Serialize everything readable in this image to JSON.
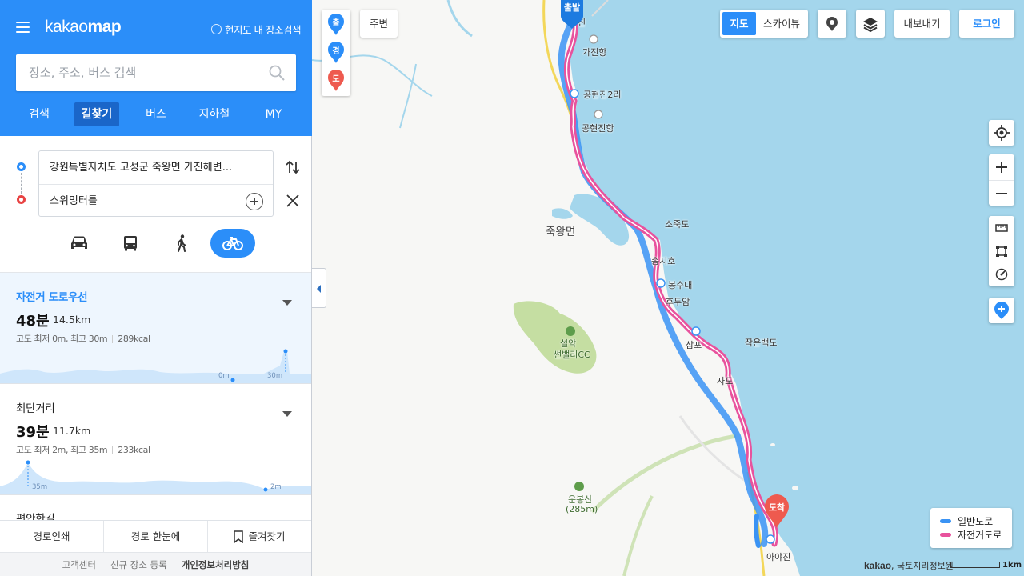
{
  "header": {
    "logo_light": "kakao",
    "logo_bold": "map",
    "local_search_label": "현지도 내 장소검색"
  },
  "search": {
    "placeholder": "장소, 주소, 버스 검색"
  },
  "tabs": [
    {
      "label": "검색"
    },
    {
      "label": "길찾기",
      "active": true
    },
    {
      "label": "버스"
    },
    {
      "label": "지하철"
    },
    {
      "label": "MY"
    }
  ],
  "route": {
    "origin": "강원특별자치도 고성군 죽왕면 가진해변...",
    "destination": "스위밍터틀"
  },
  "modes": [
    {
      "icon": "car-icon"
    },
    {
      "icon": "bus-icon"
    },
    {
      "icon": "walk-icon"
    },
    {
      "icon": "bicycle-icon",
      "active": true
    }
  ],
  "results": [
    {
      "title": "자전거 도로우선",
      "time": "48분",
      "distance": "14.5km",
      "elevation": "고도 최저 0m, 최고 30m",
      "calories": "289kcal",
      "min_label": "0m",
      "max_label": "30m",
      "selected": true
    },
    {
      "title": "최단거리",
      "time": "39분",
      "distance": "11.7km",
      "elevation": "고도 최저 2m, 최고 35m",
      "calories": "233kcal",
      "max_label": "35m",
      "min_label": "2m",
      "selected": false
    },
    {
      "title": "편안한길"
    }
  ],
  "footer": {
    "print": "경로인쇄",
    "overview": "경로 한눈에",
    "favorite": "즐겨찾기",
    "links": [
      "고객센터",
      "신규 장소 등록",
      "개인정보처리방침"
    ]
  },
  "map": {
    "pins": [
      "출",
      "경",
      "도"
    ],
    "around_label": "주변",
    "map_type_on": "지도",
    "map_type_off": "스카이뷰",
    "export_label": "내보내기",
    "login_label": "로그인",
    "start_marker": "출발",
    "end_marker": "도착",
    "labels": {
      "gajin": "가진항",
      "gonghyeon2": "공현진2리",
      "gonghyeonhang": "공현진항",
      "jukwang": "죽왕면",
      "sojukdo": "소죽도",
      "songji": "송지호",
      "bongsudae": "봉수대",
      "hudu": "후두암",
      "jakeun": "작은백도",
      "sam": "삼포",
      "ja": "자도",
      "seorak": "설악",
      "cc": "썬밸리CC",
      "unbong": "운봉산",
      "unbong_h": "(285m)",
      "ayajin": "아야진",
      "jin": "진"
    },
    "legend": [
      {
        "label": "일반도로",
        "color": "#3a93f4"
      },
      {
        "label": "자전거도로",
        "color": "#e8529d"
      }
    ],
    "copyright_brand": "kakao",
    "copyright_text": ", 국토지리정보원",
    "scale_label": "1km"
  },
  "colors": {
    "brand_blue": "#2b8ef9",
    "sea": "#a4d6ec",
    "bike_route": "#e8529d",
    "road_route": "#3a93f4"
  }
}
